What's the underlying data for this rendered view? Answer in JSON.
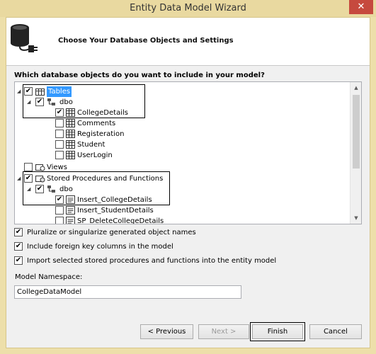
{
  "window": {
    "title": "Entity Data Model Wizard",
    "close_glyph": "✕"
  },
  "header": {
    "title": "Choose Your Database Objects and Settings",
    "icon": "database-plug-icon"
  },
  "tree": {
    "question": "Which database objects do you want to include in your model?",
    "nodes": [
      {
        "label": "Tables",
        "checked": true,
        "expanded": true
      },
      {
        "label": "dbo",
        "checked": true,
        "expanded": true
      },
      {
        "label": "CollegeDetails",
        "checked": true
      },
      {
        "label": "Comments",
        "checked": false
      },
      {
        "label": "Registeration",
        "checked": false
      },
      {
        "label": "Student",
        "checked": false
      },
      {
        "label": "UserLogin",
        "checked": false
      },
      {
        "label": "Views",
        "checked": false
      },
      {
        "label": "Stored Procedures and Functions",
        "checked": true,
        "expanded": true
      },
      {
        "label": "dbo",
        "checked": true,
        "expanded": true
      },
      {
        "label": "Insert_CollegeDetails",
        "checked": true
      },
      {
        "label": "Insert_StudentDetails",
        "checked": false
      },
      {
        "label": "SP_DeleteCollegeDetails",
        "checked": false
      }
    ]
  },
  "options": [
    {
      "label": "Pluralize or singularize generated object names",
      "checked": true
    },
    {
      "label": "Include foreign key columns in the model",
      "checked": true
    },
    {
      "label": "Import selected stored procedures and functions into the entity model",
      "checked": true
    }
  ],
  "namespace": {
    "label": "Model Namespace:",
    "value": "CollegeDataModel"
  },
  "buttons": {
    "previous": "< Previous",
    "next": "Next >",
    "finish": "Finish",
    "cancel": "Cancel"
  },
  "colors": {
    "selection": "#3399ff",
    "frame": "#eddfaa",
    "close": "#c6493e"
  }
}
